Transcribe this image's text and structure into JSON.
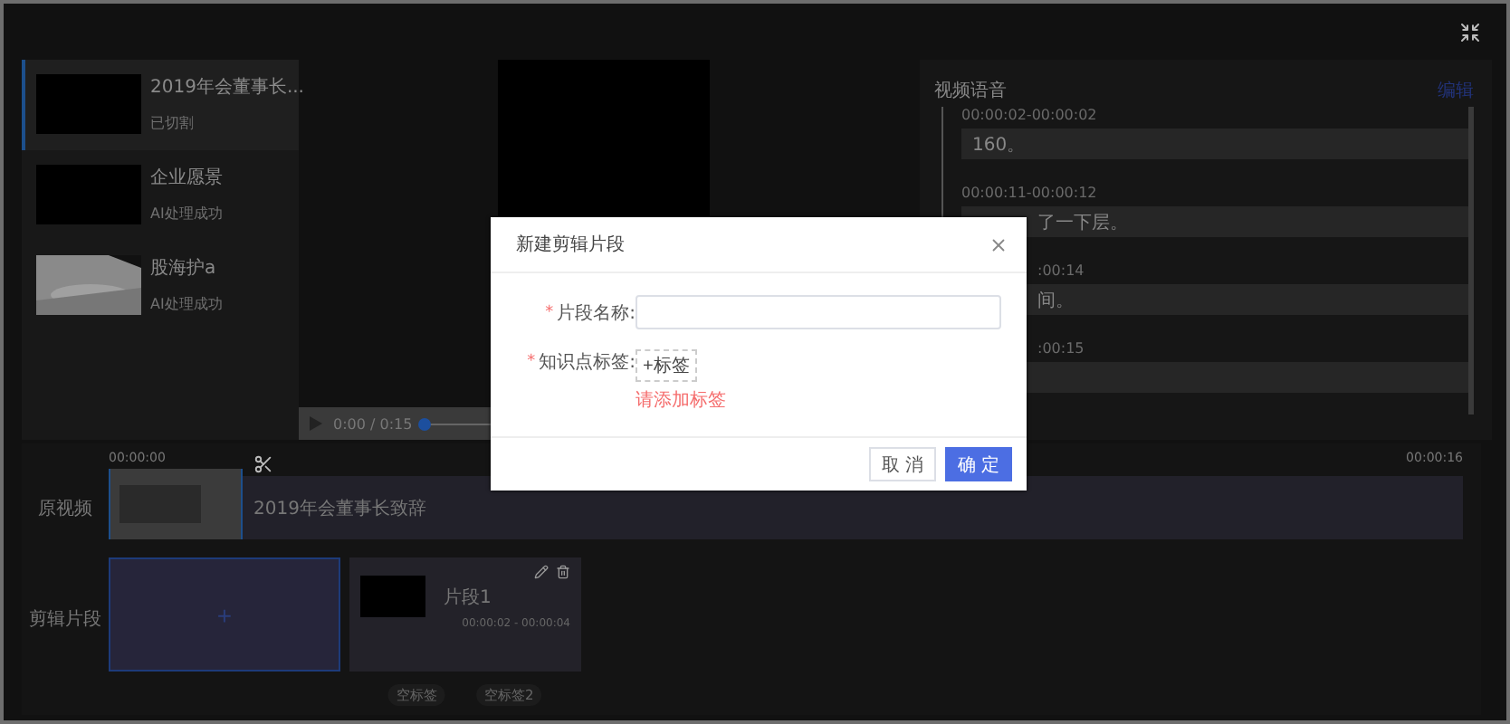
{
  "videos": [
    {
      "title": "2019年会董事长...",
      "status": "已切割",
      "selected": true,
      "kind": "blank"
    },
    {
      "title": "企业愿景",
      "status": "AI处理成功",
      "selected": false,
      "kind": "blank"
    },
    {
      "title": "股海护a",
      "status": "AI处理成功",
      "selected": false,
      "kind": "picture"
    }
  ],
  "player": {
    "time": "0:00 / 0:15",
    "level": 0
  },
  "speech": {
    "title": "视频语音",
    "action": "编辑",
    "entries": [
      {
        "time": "00:00:02-00:00:02",
        "text": "160。",
        "kind": "full"
      },
      {
        "time": "00:00:11-00:00:12",
        "text": "了一下层。",
        "kind": "text-cut"
      },
      {
        "time": ":00:14",
        "text": "间。",
        "kind": "cut"
      },
      {
        "time": ":00:15",
        "kind": "cut"
      }
    ]
  },
  "timeline": {
    "start": "00:00:00",
    "end": "00:00:16",
    "source": {
      "label": "原视频",
      "clip": "2019年会董事长致辞"
    },
    "clips": {
      "label": "剪辑片段",
      "add": "+",
      "items": [
        {
          "name": "片段1",
          "range": "00:00:02 - 00:00:04",
          "tags": [
            "空标签",
            "空标签2"
          ]
        }
      ]
    }
  },
  "modal": {
    "title": "新建剪辑片段",
    "fields": [
      {
        "label": "片段名称:",
        "required": true,
        "kind": "input"
      },
      {
        "label": "知识点标签:",
        "required": true,
        "kind": "tags",
        "button": "+标签",
        "error": "请添加标签"
      }
    ],
    "required_mark": "*",
    "buttons": [
      {
        "label": "取 消",
        "primary": false
      },
      {
        "label": "确 定",
        "primary": true
      }
    ]
  }
}
